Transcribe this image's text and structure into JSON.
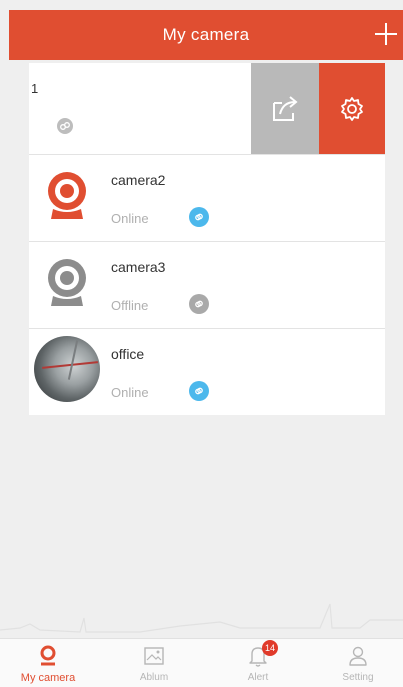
{
  "header": {
    "title": "My camera",
    "add_icon": "plus-icon"
  },
  "colors": {
    "accent": "#e04e31",
    "online": "#4cb8ec",
    "offline": "#a9a9a9",
    "swipe_share_bg": "#b9b9b9"
  },
  "swiped_row": {
    "name": "1",
    "share_icon": "share-icon",
    "settings_icon": "gear-icon"
  },
  "cameras": [
    {
      "name": "camera2",
      "status": "Online",
      "icon": "webcam-icon-red"
    },
    {
      "name": "camera3",
      "status": "Offline",
      "icon": "webcam-icon-gray"
    },
    {
      "name": "office",
      "status": "Online",
      "icon": "camera-thumbnail"
    }
  ],
  "tabbar": {
    "tabs": [
      {
        "label": "My camera",
        "icon": "location-pin-icon",
        "active": true
      },
      {
        "label": "Ablum",
        "icon": "album-icon"
      },
      {
        "label": "Alert",
        "icon": "bell-icon",
        "badge": "14"
      },
      {
        "label": "Setting",
        "icon": "user-icon"
      }
    ]
  }
}
